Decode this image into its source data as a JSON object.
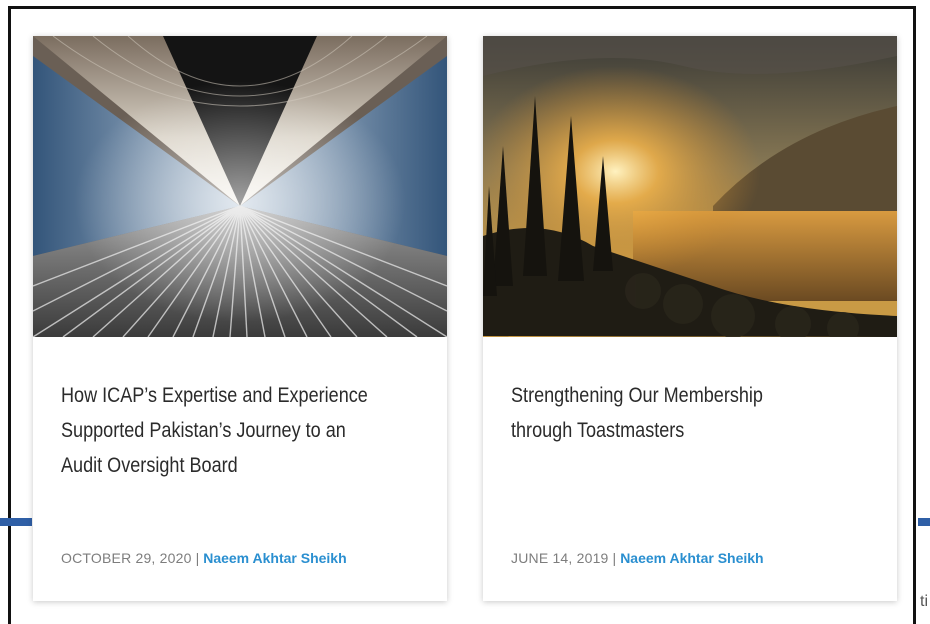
{
  "cards": [
    {
      "title_line1": "How ICAP’s Expertise and Experience",
      "title_line2": "Supported Pakistan’s Journey to an",
      "title_line3": "Audit Oversight Board",
      "date": "OCTOBER 29, 2020",
      "separator": "|",
      "author": "Naeem Akhtar Sheikh"
    },
    {
      "title_line1": "Strengthening Our Membership",
      "title_line2": "through Toastmasters",
      "title_line3": "",
      "date": "JUNE 14, 2019",
      "separator": "|",
      "author": "Naeem Akhtar Sheikh"
    }
  ],
  "edge_text": "ti",
  "colors": {
    "accent_blue": "#2a8fd0",
    "rule_blue": "#2f5fa6",
    "meta_gray": "#7d7d7d",
    "title": "#2b2b2b"
  }
}
